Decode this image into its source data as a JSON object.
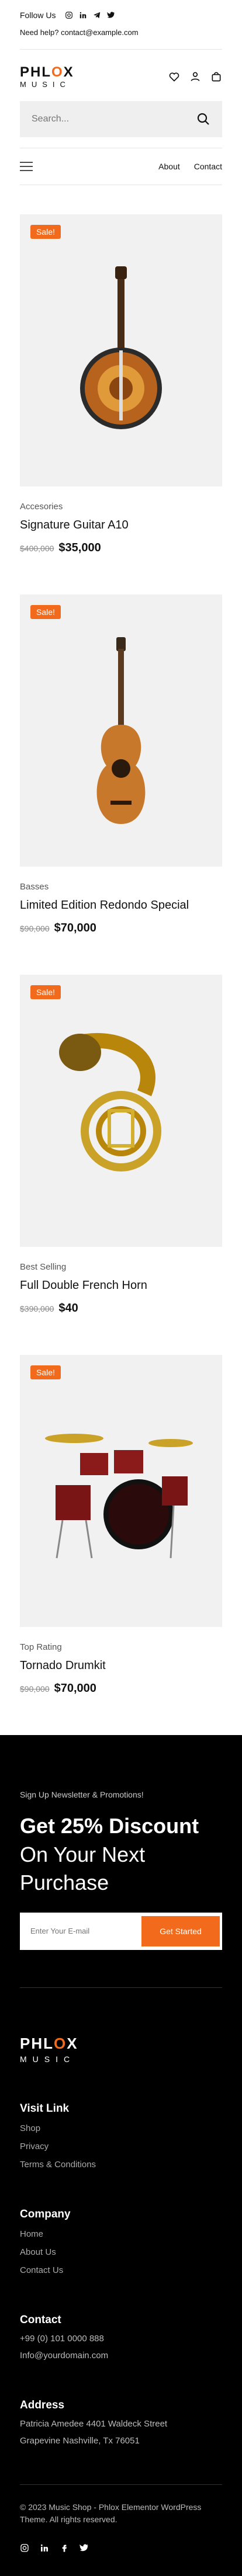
{
  "topbar": {
    "follow_label": "Follow Us",
    "help_text": "Need help? contact@example.com"
  },
  "brand": {
    "name_top": "PHL",
    "name_dot": "O",
    "name_end": "X",
    "name_bottom": "MUSIC",
    "accent": "#f26b1d"
  },
  "search": {
    "placeholder": "Search..."
  },
  "nav": {
    "about": "About",
    "contact": "Contact"
  },
  "products": [
    {
      "badge": "Sale!",
      "category": "Accesories",
      "name": "Signature Guitar A10",
      "old_price": "$400,000",
      "new_price": "$35,000"
    },
    {
      "badge": "Sale!",
      "category": "Basses",
      "name": "Limited Edition Redondo Special",
      "old_price": "$90,000",
      "new_price": "$70,000"
    },
    {
      "badge": "Sale!",
      "category": "Best Selling",
      "name": "Full Double French Horn",
      "old_price": "$390,000",
      "new_price": "$40"
    },
    {
      "badge": "Sale!",
      "category": "Top Rating",
      "name": "Tornado Drumkit",
      "old_price": "$90,000",
      "new_price": "$70,000"
    }
  ],
  "newsletter": {
    "small": "Sign Up Newsletter & Promotions!",
    "bold": "Get 25% Discount",
    "rest": "On Your Next Purchase",
    "placeholder": "Enter Your E-mail",
    "button": "Get Started"
  },
  "footer": {
    "visit_title": "Visit Link",
    "visit_links": [
      "Shop",
      "Privacy",
      "Terms & Conditions"
    ],
    "company_title": "Company",
    "company_links": [
      "Home",
      "About Us",
      "Contact Us"
    ],
    "contact_title": "Contact",
    "contact_lines": [
      "+99 (0) 101 0000 888",
      "Info@yourdomain.com"
    ],
    "address_title": "Address",
    "address_lines": [
      "Patricia Amedee 4401 Waldeck Street",
      "Grapevine Nashville, Tx 76051"
    ],
    "copyright": "© 2023 Music Shop - Phlox Elementor WordPress Theme. All rights reserved."
  }
}
